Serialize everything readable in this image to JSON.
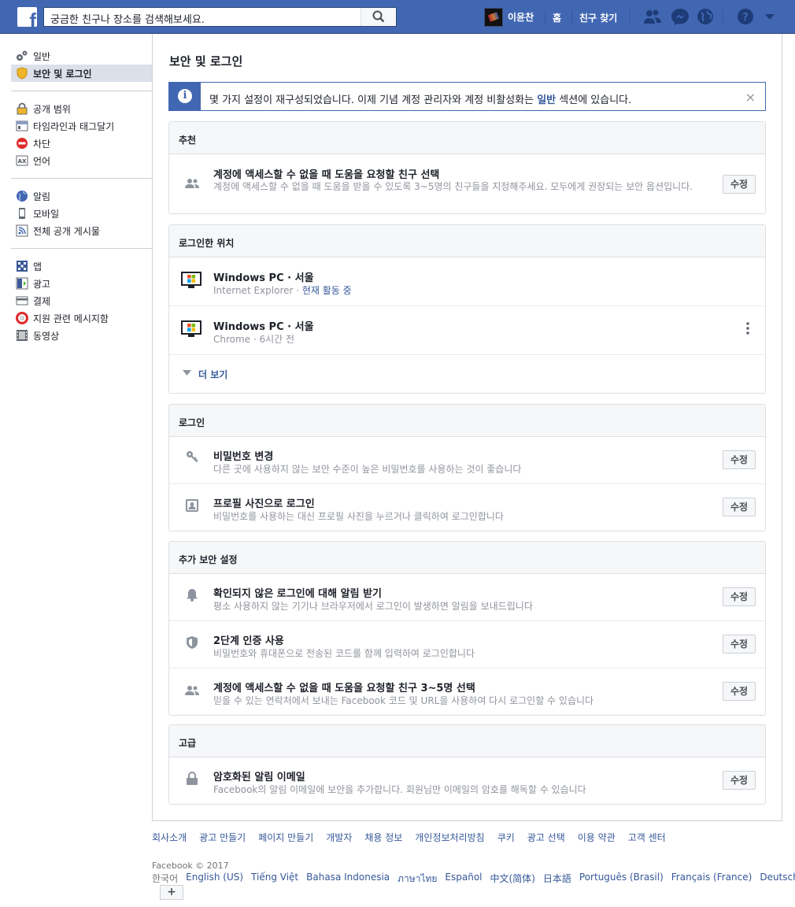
{
  "topbar": {
    "search_placeholder": "궁금한 친구나 장소를 검색해보세요.",
    "user_name": "이윤찬",
    "home": "홈",
    "find_friends": "친구 찾기"
  },
  "sidebar": {
    "groups": [
      [
        {
          "label": "일반",
          "icon": "gears-icon"
        },
        {
          "label": "보안 및 로그인",
          "icon": "shield-badge-icon",
          "active": true
        }
      ],
      [
        {
          "label": "공개 범위",
          "icon": "lock-icon"
        },
        {
          "label": "타임라인과 태그달기",
          "icon": "timeline-icon"
        },
        {
          "label": "차단",
          "icon": "block-icon"
        },
        {
          "label": "언어",
          "icon": "language-icon"
        }
      ],
      [
        {
          "label": "알림",
          "icon": "globe-icon"
        },
        {
          "label": "모바일",
          "icon": "mobile-icon"
        },
        {
          "label": "전체 공개 게시물",
          "icon": "rss-icon"
        }
      ],
      [
        {
          "label": "앱",
          "icon": "apps-icon"
        },
        {
          "label": "광고",
          "icon": "ads-icon"
        },
        {
          "label": "결제",
          "icon": "card-icon"
        },
        {
          "label": "지원 관련 메시지함",
          "icon": "lifebuoy-icon"
        },
        {
          "label": "동영상",
          "icon": "film-icon"
        }
      ]
    ]
  },
  "main": {
    "title": "보안 및 로그인",
    "notice": {
      "text_before": "몇 가지 설정이 재구성되었습니다. 이제 기념 계정 관리자와 계정 비활성화는 ",
      "link": "일반",
      "text_after": " 섹션에 있습니다.",
      "close": "×"
    },
    "edit_label": "수정",
    "sections": {
      "recommended": {
        "heading": "추천",
        "rows": [
          {
            "title": "계정에 액세스할 수 없을 때 도움을 요청할 친구 선택",
            "desc": "계정에 액세스할 수 없을 때 도움을 받을 수 있도록 3~5명의 친구들을 지정해주세요. 모두에게 권장되는 보안 옵션입니다."
          }
        ]
      },
      "where_logged_in": {
        "heading": "로그인한 위치",
        "sessions": [
          {
            "title": "Windows PC · 서울",
            "meta": "Internet Explorer · ",
            "status": "현재 활동 중"
          },
          {
            "title": "Windows PC · 서울",
            "meta": "Chrome · 6시간 전",
            "status": ""
          }
        ],
        "see_more": "더 보기"
      },
      "login": {
        "heading": "로그인",
        "rows": [
          {
            "title": "비밀번호 변경",
            "desc": "다른 곳에 사용하지 않는 보안 수준이 높은 비밀번호를 사용하는 것이 좋습니다"
          },
          {
            "title": "프로필 사진으로 로그인",
            "desc": "비밀번호를 사용하는 대신 프로필 사진을 누르거나 클릭하여 로그인합니다"
          }
        ]
      },
      "extra_security": {
        "heading": "추가 보안 설정",
        "rows": [
          {
            "title": "확인되지 않은 로그인에 대해 알림 받기",
            "desc": "평소 사용하지 않는 기기나 브라우저에서 로그인이 발생하면 알림을 보내드립니다"
          },
          {
            "title": "2단계 인증 사용",
            "desc": "비밀번호와 휴대폰으로 전송된 코드를 함께 입력하여 로그인합니다"
          },
          {
            "title": "계정에 액세스할 수 없을 때 도움을 요청할 친구 3~5명 선택",
            "desc": "믿을 수 있는 연락처에서 보내는 Facebook 코드 및 URL을 사용하여 다시 로그인할 수 있습니다"
          }
        ]
      },
      "advanced": {
        "heading": "고급",
        "rows": [
          {
            "title": "암호화된 알림 이메일",
            "desc": "Facebook의 알림 이메일에 보안을 추가합니다. 회원님만 이메일의 암호를 해독할 수 있습니다"
          }
        ]
      }
    }
  },
  "footer": {
    "links": [
      "회사소개",
      "광고 만들기",
      "페이지 만들기",
      "개발자",
      "채용 정보",
      "개인정보처리방침",
      "쿠키",
      "광고 선택",
      "이용 약관",
      "고객 센터"
    ],
    "copyright": "Facebook © 2017",
    "languages": [
      "한국어",
      "English (US)",
      "Tiếng Việt",
      "Bahasa Indonesia",
      "ภาษาไทย",
      "Español",
      "中文(简体)",
      "日本語",
      "Português (Brasil)",
      "Français (France)",
      "Deutsch"
    ],
    "more": "+"
  },
  "colors": {
    "brand": "#4267b2",
    "link": "#365899",
    "muted": "#90949c"
  }
}
